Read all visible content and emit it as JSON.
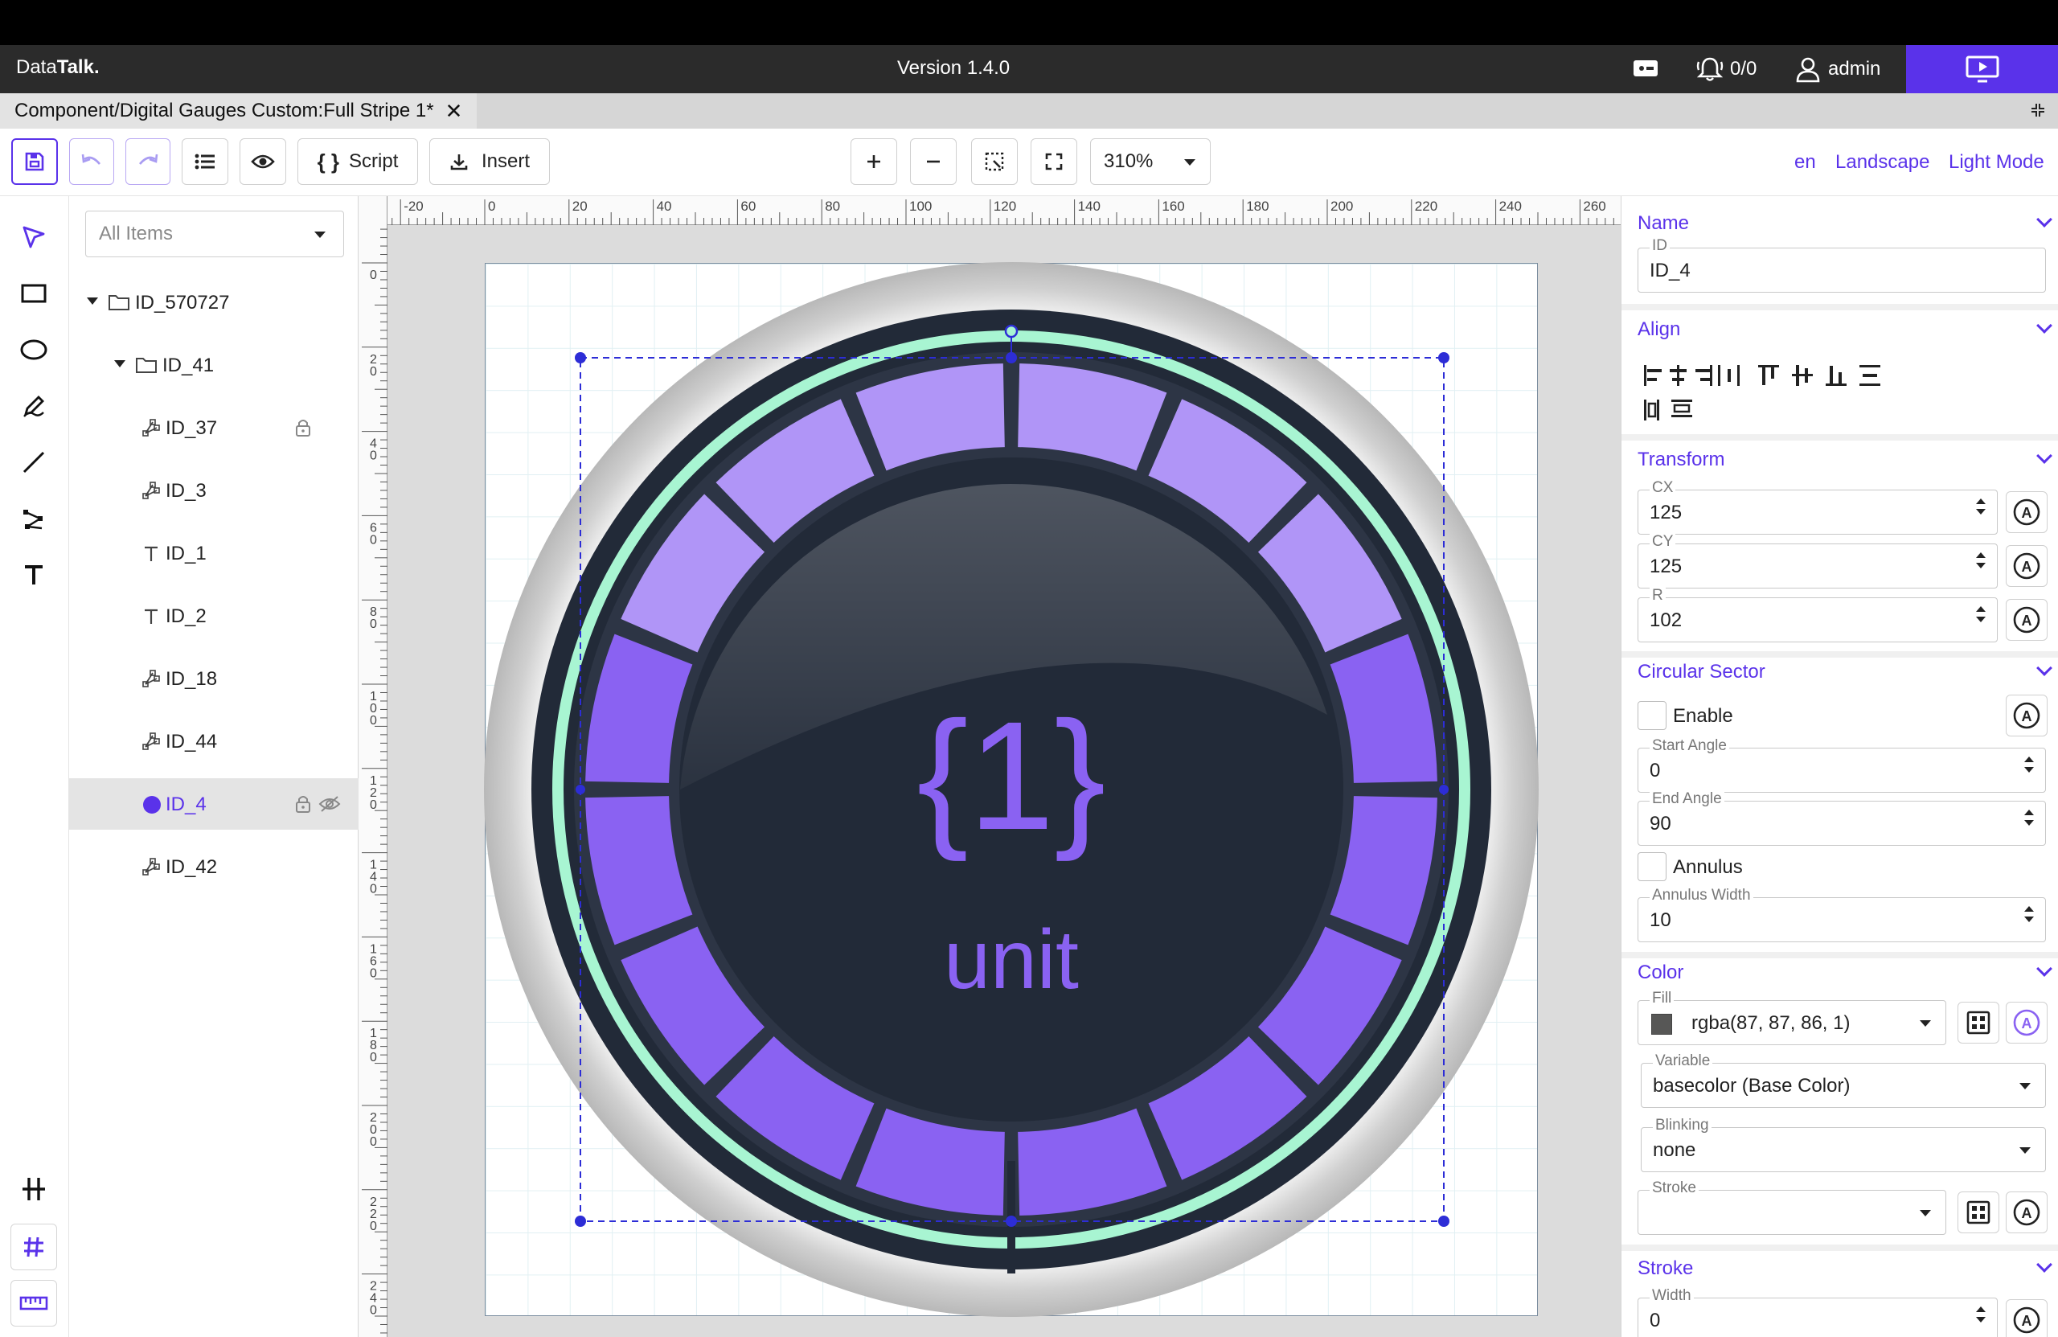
{
  "header": {
    "brand_light": "Data",
    "brand_bold": "Talk.",
    "version": "Version 1.4.0",
    "alarms": "0/0",
    "user": "admin"
  },
  "doc_tab": {
    "title": "Component/Digital Gauges Custom:Full Stripe 1*",
    "close": "✕"
  },
  "toolbar": {
    "script_label": "Script",
    "insert_label": "Insert",
    "zoom": "310%",
    "language": "en",
    "orientation": "Landscape",
    "theme": "Light Mode"
  },
  "layers": {
    "filter": "All Items",
    "items": [
      {
        "label": "ID_570727",
        "kind": "folder"
      },
      {
        "label": "ID_41",
        "kind": "folder"
      },
      {
        "label": "ID_37",
        "kind": "path"
      },
      {
        "label": "ID_3",
        "kind": "path"
      },
      {
        "label": "ID_1",
        "kind": "text"
      },
      {
        "label": "ID_2",
        "kind": "text"
      },
      {
        "label": "ID_18",
        "kind": "path"
      },
      {
        "label": "ID_44",
        "kind": "path"
      },
      {
        "label": "ID_4",
        "kind": "circle"
      },
      {
        "label": "ID_42",
        "kind": "path"
      }
    ]
  },
  "canvas": {
    "ruler_top": [
      "-20",
      "0",
      "20",
      "40",
      "60",
      "80",
      "100",
      "120",
      "140",
      "160",
      "180",
      "200",
      "220",
      "240",
      "260"
    ],
    "ruler_left": [
      "0",
      "20",
      "40",
      "60",
      "80",
      "100",
      "120",
      "140",
      "160",
      "180",
      "200",
      "220",
      "240"
    ],
    "gauge_value": "{1}",
    "gauge_unit": "unit",
    "colors": {
      "segment": "#8a62f2",
      "segment_top": "#b095f7",
      "ring": "#a8f5d2",
      "dark": "#222a38"
    }
  },
  "props": {
    "name": {
      "title": "Name",
      "id_label": "ID",
      "id_value": "ID_4"
    },
    "align": {
      "title": "Align"
    },
    "transform": {
      "title": "Transform",
      "cx_label": "CX",
      "cx": "125",
      "cy_label": "CY",
      "cy": "125",
      "r_label": "R",
      "r": "102"
    },
    "sector": {
      "title": "Circular Sector",
      "enable": "Enable",
      "start_label": "Start Angle",
      "start": "0",
      "end_label": "End Angle",
      "end": "90",
      "annulus": "Annulus",
      "annulus_width_label": "Annulus Width",
      "annulus_width": "10"
    },
    "color": {
      "title": "Color",
      "fill_label": "Fill",
      "fill": "rgba(87, 87, 86, 1)",
      "fill_swatch": "#575756",
      "variable_label": "Variable",
      "variable": "basecolor (Base Color)",
      "blinking_label": "Blinking",
      "blinking": "none",
      "stroke_label": "Stroke"
    },
    "stroke": {
      "title": "Stroke",
      "width_label": "Width",
      "width": "0"
    }
  }
}
